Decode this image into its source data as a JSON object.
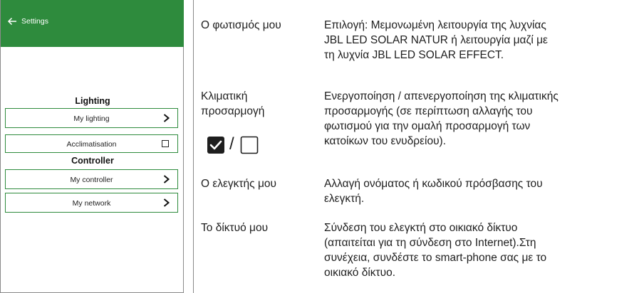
{
  "phone": {
    "header_title": "Settings",
    "icons": {
      "back": "arrow-left-icon",
      "chevron": "chevron-right-icon",
      "checkbox": "checkbox-empty-icon"
    },
    "colors": {
      "accent": "#2e8b3d"
    },
    "sections": [
      {
        "title": "Lighting",
        "items": [
          {
            "label": "My lighting"
          },
          {
            "label": "Acclimatisation"
          }
        ]
      },
      {
        "title": "Controller",
        "items": [
          {
            "label": "My controller"
          },
          {
            "label": "My network"
          }
        ]
      }
    ]
  },
  "table": {
    "rows": [
      {
        "term": "Ο φωτισμός μου",
        "desc_lines": [
          "Επιλογή: Μεμονωμένη λειτουργία της λυχνίας",
          "JBL LED SOLAR NATUR ή λειτουργία μαζί με",
          "τη λυχνία JBL LED SOLAR EFFECT."
        ]
      },
      {
        "term_lines": [
          "Κλιματική",
          "προσαρμογή"
        ],
        "desc_lines": [
          "Ενεργοποίηση / απενεργοποίηση της κλιματικής",
          "προσαρμογής (σε περίπτωση αλλαγής του",
          "φωτισμού για την ομαλή προσαρμογή των",
          "κατοίκων του ενυδρείου)."
        ],
        "icons": [
          "checkbox-checked-icon",
          "checkbox-empty-icon"
        ],
        "icon_separator": "/"
      },
      {
        "term": "Ο ελεγκτής μου",
        "desc_lines": [
          "Αλλαγή ονόματος ή κωδικού πρόσβασης του",
          "ελεγκτή."
        ]
      },
      {
        "term": "Το δίκτυό μου",
        "desc_lines": [
          "Σύνδεση του ελεγκτή στο οικιακό δίκτυο",
          "(απαιτείται για τη σύνδεση στο Internet).Στη",
          "συνέχεια, συνδέστε το smart-phone σας με το",
          "οικιακό δίκτυο."
        ]
      }
    ]
  }
}
